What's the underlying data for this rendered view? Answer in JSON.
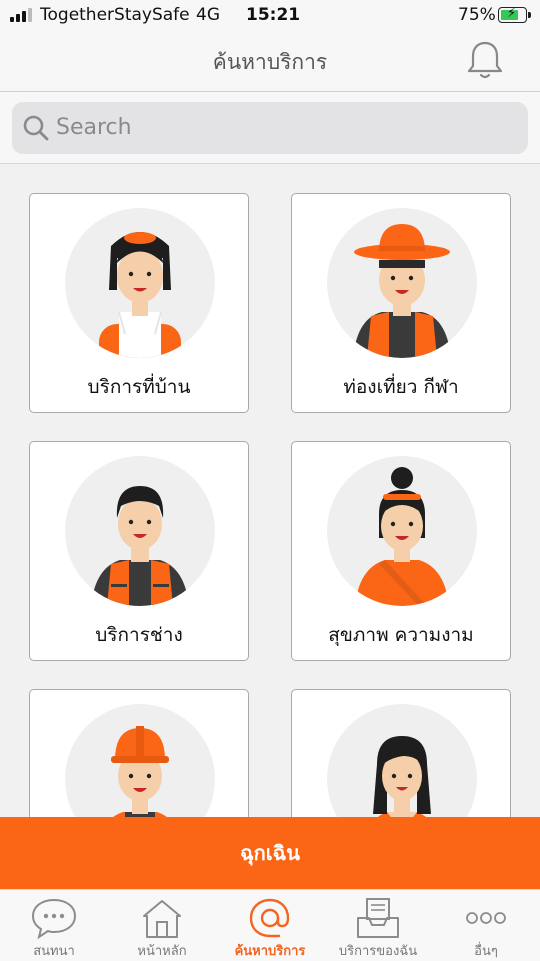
{
  "status_bar": {
    "carrier": "TogetherStaySafe",
    "network": "4G",
    "time": "15:21",
    "battery": "75%",
    "battery_level": 0.75
  },
  "header": {
    "title": "ค้นหาบริการ",
    "bell_icon": "bell-icon"
  },
  "search": {
    "placeholder": "Search",
    "icon": "search-icon"
  },
  "services": [
    {
      "label": "บริการที่บ้าน",
      "icon": "housekeeper-avatar"
    },
    {
      "label": "ท่องเที่ยว กีฬา",
      "icon": "tour-guide-avatar"
    },
    {
      "label": "บริการช่าง",
      "icon": "technician-avatar"
    },
    {
      "label": "สุขภาพ ความงาม",
      "icon": "health-beauty-avatar"
    },
    {
      "label": "",
      "icon": "construction-worker-avatar"
    },
    {
      "label": "",
      "icon": "woman-avatar"
    }
  ],
  "emergency_button": "ฉุกเฉิน",
  "tabs": [
    {
      "label": "สนทนา",
      "icon": "chat-icon",
      "active": false
    },
    {
      "label": "หน้าหลัก",
      "icon": "home-icon",
      "active": false
    },
    {
      "label": "ค้นหาบริการ",
      "icon": "at-icon",
      "active": true
    },
    {
      "label": "บริการของฉัน",
      "icon": "inbox-icon",
      "active": false
    },
    {
      "label": "อื่นๆ",
      "icon": "more-icon",
      "active": false
    }
  ],
  "colors": {
    "accent": "#fa6616",
    "tab_active": "#f26522",
    "skin": "#f4cfa9",
    "dark": "#3a3a3a"
  }
}
